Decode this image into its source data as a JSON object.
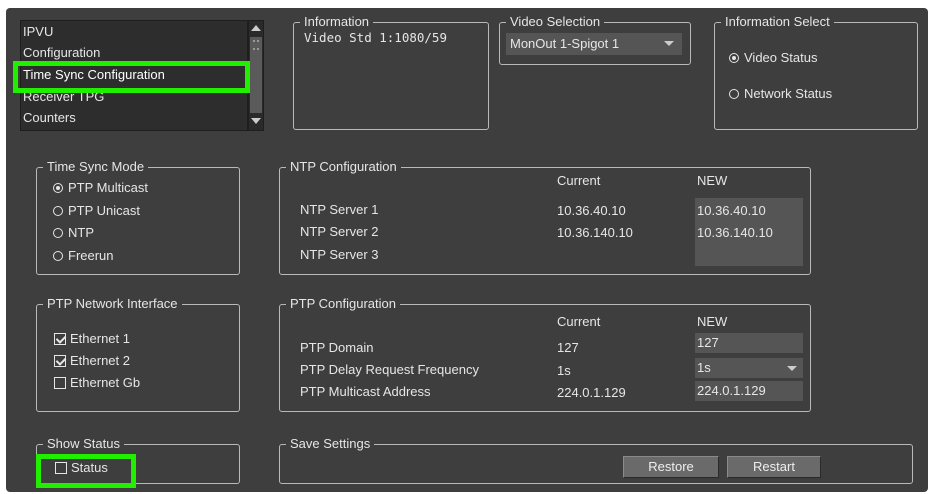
{
  "nav_list": {
    "items": [
      "IPVU",
      "Configuration",
      "Time Sync Configuration",
      "Receiver TPG",
      "Counters"
    ],
    "selected": "Time Sync Configuration"
  },
  "information": {
    "legend": "Information",
    "text": "Video Std 1:1080/59"
  },
  "video_selection": {
    "legend": "Video Selection",
    "value": "MonOut 1-Spigot 1"
  },
  "information_select": {
    "legend": "Information Select",
    "options": [
      "Video Status",
      "Network Status"
    ],
    "selected": "Video Status"
  },
  "time_sync_mode": {
    "legend": "Time Sync Mode",
    "options": [
      "PTP Multicast",
      "PTP Unicast",
      "NTP",
      "Freerun"
    ],
    "selected": "PTP Multicast"
  },
  "ntp_config": {
    "legend": "NTP Configuration",
    "col_current": "Current",
    "col_new": "NEW",
    "rows": [
      {
        "label": "NTP Server 1",
        "current": "10.36.40.10",
        "new": "10.36.40.10"
      },
      {
        "label": "NTP Server 2",
        "current": "10.36.140.10",
        "new": "10.36.140.10"
      },
      {
        "label": "NTP Server 3",
        "current": "",
        "new": ""
      }
    ]
  },
  "ptp_network": {
    "legend": "PTP Network Interface",
    "items": [
      {
        "label": "Ethernet 1",
        "checked": true
      },
      {
        "label": "Ethernet 2",
        "checked": true
      },
      {
        "label": "Ethernet Gb",
        "checked": false
      }
    ]
  },
  "ptp_config": {
    "legend": "PTP Configuration",
    "col_current": "Current",
    "col_new": "NEW",
    "rows": [
      {
        "label": "PTP Domain",
        "current": "127",
        "new": "127"
      },
      {
        "label": "PTP Delay Request Frequency",
        "current": "1s",
        "new": "1s"
      },
      {
        "label": "PTP Multicast Address",
        "current": "224.0.1.129",
        "new": "224.0.1.129"
      }
    ]
  },
  "show_status": {
    "legend": "Show Status",
    "checkbox_label": "Status",
    "checked": false
  },
  "save_settings": {
    "legend": "Save Settings",
    "restore_label": "Restore",
    "restart_label": "Restart"
  },
  "colors": {
    "panel": "#3e3e3e",
    "highlight": "#22ee00",
    "field": "#555555"
  }
}
